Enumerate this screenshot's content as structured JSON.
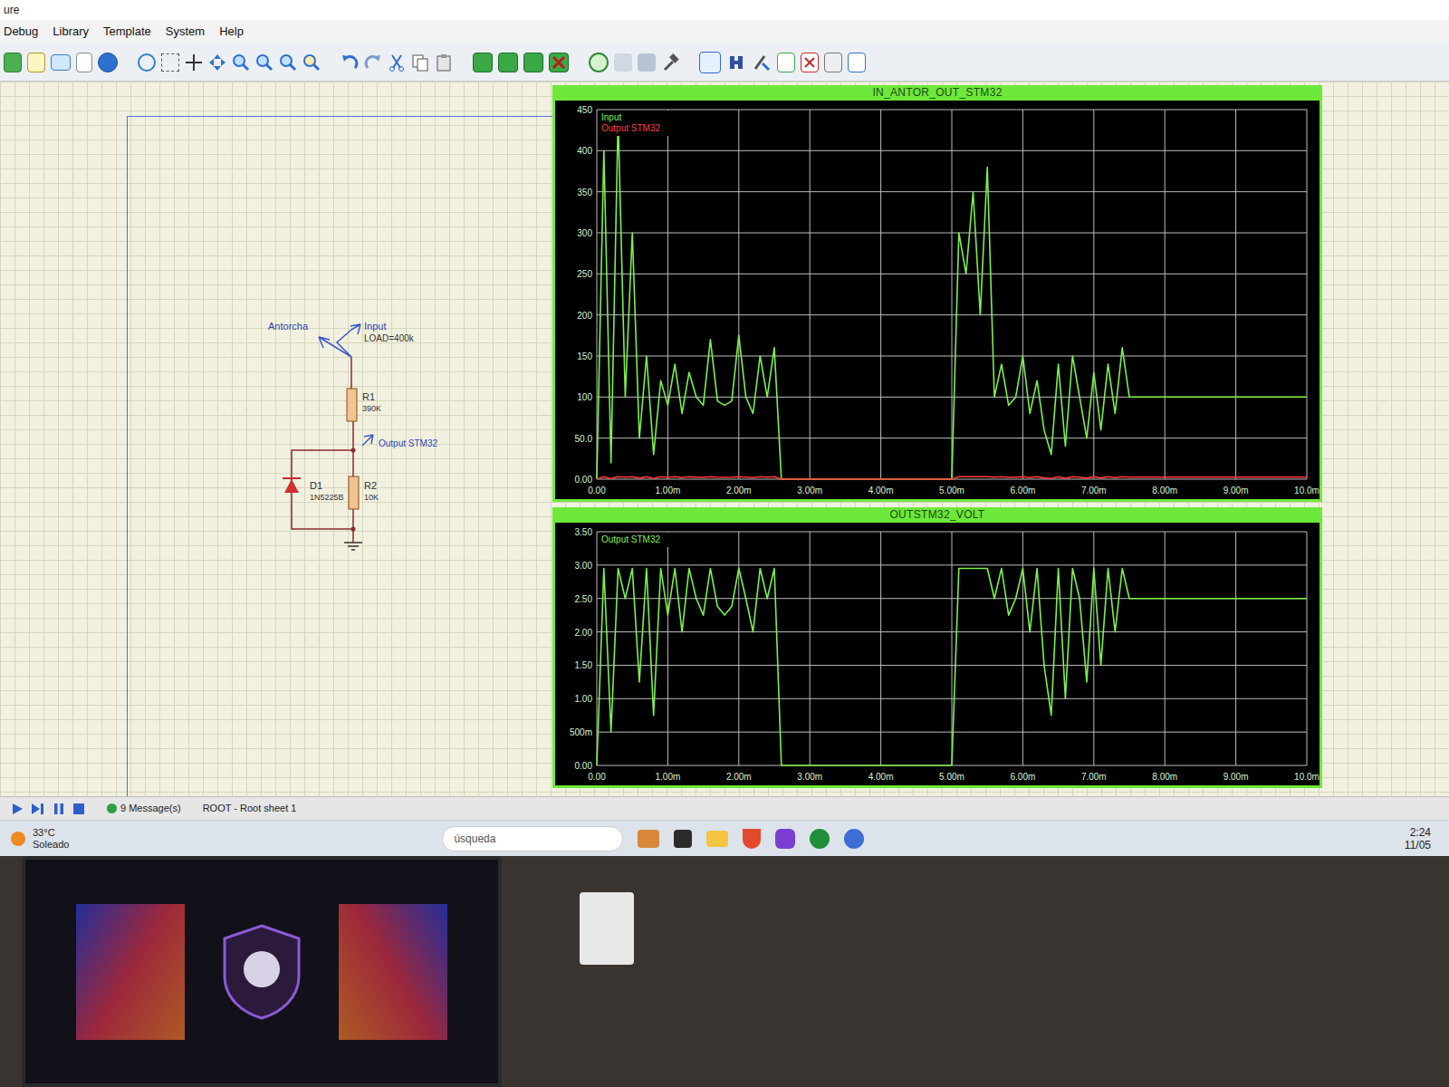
{
  "window": {
    "title": "ure"
  },
  "menu": [
    "Debug",
    "Library",
    "Template",
    "System",
    "Help"
  ],
  "schematic": {
    "generator": "Antorcha",
    "input": "Input",
    "load": "LOAD=400k",
    "r1": "R1",
    "r1_value": "390K",
    "output": "Output STM32",
    "d1": "D1",
    "d1_value": "1N5225B",
    "r2": "R2",
    "r2_value": "10K"
  },
  "charts": [
    {
      "title": "IN_ANTOR_OUT_STM32",
      "y_ticks": [
        "0.00",
        "50.0",
        "100",
        "150",
        "200",
        "250",
        "300",
        "350",
        "400",
        "450"
      ],
      "x_ticks": [
        "0.00",
        "1.00m",
        "2.00m",
        "3.00m",
        "4.00m",
        "5.00m",
        "6.00m",
        "7.00m",
        "8.00m",
        "9.00m",
        "10.0m"
      ],
      "series": [
        {
          "name": "Input",
          "color": "#7cf04a",
          "values": [
            0,
            400,
            20,
            440,
            100,
            300,
            50,
            150,
            30,
            120,
            90,
            140,
            80,
            130,
            100,
            90,
            170,
            95,
            90,
            95,
            175,
            100,
            80,
            150,
            100,
            160,
            0,
            0,
            0,
            0,
            0,
            0,
            0,
            0,
            0,
            0,
            0,
            0,
            0,
            0,
            0,
            0,
            0,
            0,
            0,
            0,
            0,
            0,
            0,
            0,
            0,
            300,
            250,
            350,
            200,
            380,
            100,
            140,
            90,
            100,
            150,
            80,
            120,
            60,
            30,
            140,
            40,
            150,
            100,
            50,
            130,
            60,
            140,
            80,
            160,
            100,
            100,
            100,
            100,
            100,
            100,
            100,
            100,
            100,
            100,
            100,
            100,
            100,
            100,
            100,
            100,
            100,
            100,
            100,
            100,
            100,
            100,
            100,
            100,
            100,
            100
          ]
        },
        {
          "name": "Output STM32",
          "color": "#ff3b3b",
          "values": [
            0,
            2.95,
            0.5,
            2.95,
            2.5,
            2.95,
            1.25,
            2.95,
            0.75,
            2.95,
            2.25,
            2.95,
            2,
            2.95,
            2.5,
            2.25,
            2.95,
            2.38,
            2.25,
            2.38,
            2.95,
            2.5,
            2,
            2.95,
            2.5,
            2.95,
            0,
            0,
            0,
            0,
            0,
            0,
            0,
            0,
            0,
            0,
            0,
            0,
            0,
            0,
            0,
            0,
            0,
            0,
            0,
            0,
            0,
            0,
            0,
            0,
            0,
            2.95,
            2.95,
            2.95,
            2.95,
            2.95,
            2.5,
            2.95,
            2.25,
            2.5,
            2.95,
            2,
            2.95,
            1.5,
            0.75,
            2.95,
            1,
            2.95,
            2.5,
            1.25,
            2.95,
            1.5,
            2.95,
            2,
            2.95,
            2.5,
            2.5,
            2.5,
            2.5,
            2.5,
            2.5,
            2.5,
            2.5,
            2.5,
            2.5,
            2.5,
            2.5,
            2.5,
            2.5,
            2.5,
            2.5,
            2.5,
            2.5,
            2.5,
            2.5,
            2.5,
            2.5,
            2.5,
            2.5,
            2.5,
            2.5
          ]
        }
      ]
    },
    {
      "title": "OUTSTM32_VOLT",
      "y_ticks": [
        "0.00",
        "500m",
        "1.00",
        "1.50",
        "2.00",
        "2.50",
        "3.00",
        "3.50"
      ],
      "x_ticks": [
        "0.00",
        "1.00m",
        "2.00m",
        "3.00m",
        "4.00m",
        "5.00m",
        "6.00m",
        "7.00m",
        "8.00m",
        "9.00m",
        "10.0m"
      ],
      "series": [
        {
          "name": "Output STM32",
          "color": "#7cf04a",
          "values": [
            0,
            2.95,
            0.5,
            2.95,
            2.5,
            2.95,
            1.25,
            2.95,
            0.75,
            2.95,
            2.25,
            2.95,
            2,
            2.95,
            2.5,
            2.25,
            2.95,
            2.38,
            2.25,
            2.38,
            2.95,
            2.5,
            2,
            2.95,
            2.5,
            2.95,
            0,
            0,
            0,
            0,
            0,
            0,
            0,
            0,
            0,
            0,
            0,
            0,
            0,
            0,
            0,
            0,
            0,
            0,
            0,
            0,
            0,
            0,
            0,
            0,
            0,
            2.95,
            2.95,
            2.95,
            2.95,
            2.95,
            2.5,
            2.95,
            2.25,
            2.5,
            2.95,
            2,
            2.95,
            1.5,
            0.75,
            2.95,
            1,
            2.95,
            2.5,
            1.25,
            2.95,
            1.5,
            2.95,
            2,
            2.95,
            2.5,
            2.5,
            2.5,
            2.5,
            2.5,
            2.5,
            2.5,
            2.5,
            2.5,
            2.5,
            2.5,
            2.5,
            2.5,
            2.5,
            2.5,
            2.5,
            2.5,
            2.5,
            2.5,
            2.5,
            2.5,
            2.5,
            2.5,
            2.5,
            2.5,
            2.5
          ]
        }
      ]
    }
  ],
  "status_bar": {
    "messages": "9 Message(s)",
    "sheet": "ROOT - Root sheet 1"
  },
  "taskbar": {
    "weather_temp": "33°C",
    "weather_text": "Soleado",
    "search": "úsqueda",
    "time": "2:24",
    "date": "11/05"
  }
}
